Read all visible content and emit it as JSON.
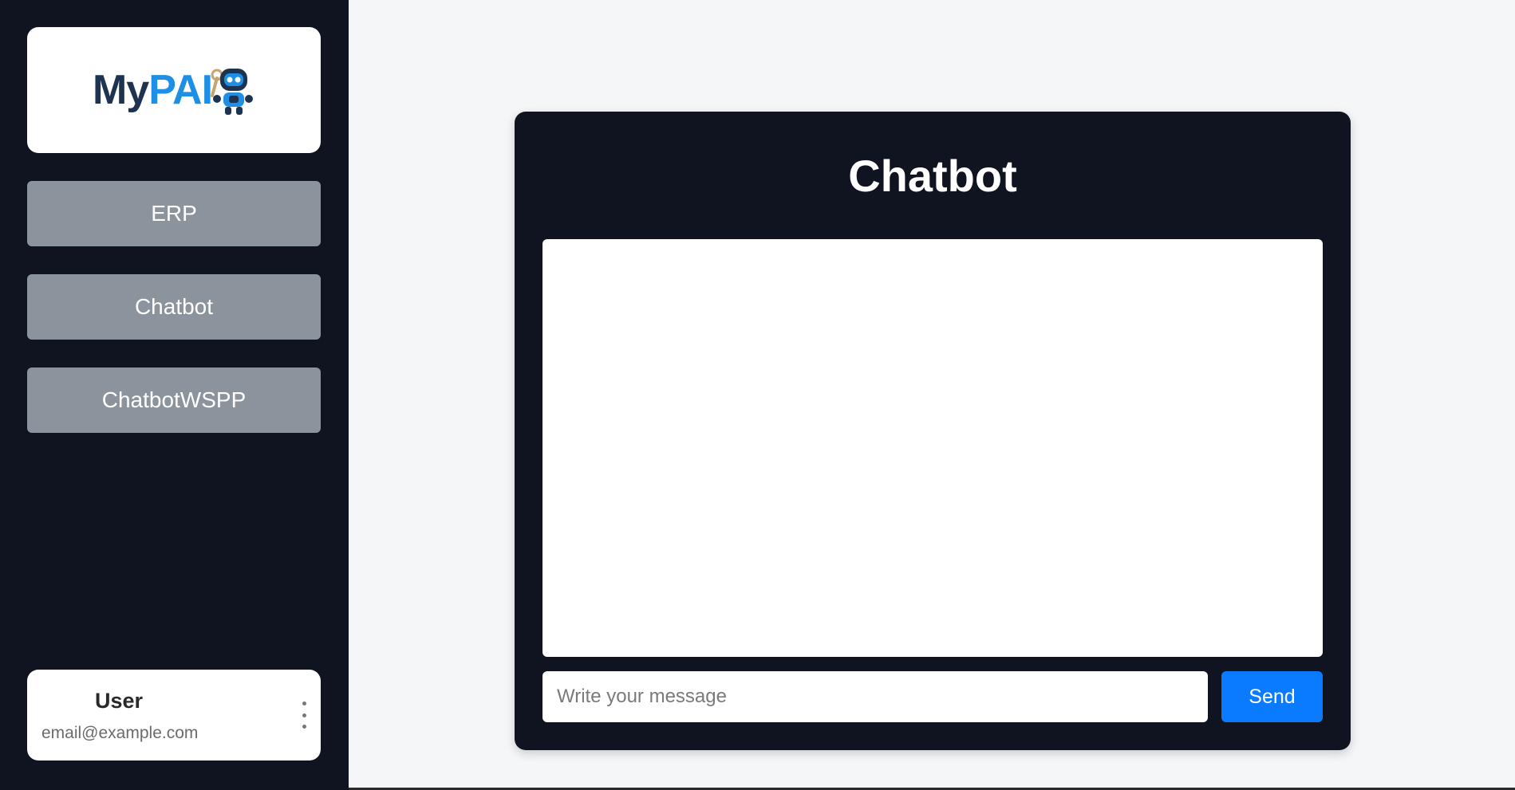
{
  "logo": {
    "text_my": "My",
    "text_pai": "PAI"
  },
  "sidebar": {
    "nav_items": [
      {
        "label": "ERP"
      },
      {
        "label": "Chatbot"
      },
      {
        "label": "ChatbotWSPP"
      }
    ],
    "user": {
      "name": "User",
      "email": "email@example.com",
      "menu_icon": "kebab-vertical-icon"
    }
  },
  "chat": {
    "title": "Chatbot",
    "input_placeholder": "Write your message",
    "input_value": "",
    "send_label": "Send"
  },
  "colors": {
    "sidebar_bg": "#101420",
    "panel_bg": "#101420",
    "nav_button_bg": "#8b939d",
    "send_button_bg": "#0a7bff",
    "page_bg": "#f5f6f8",
    "logo_dark": "#1e3350",
    "logo_blue": "#1e8fe6"
  }
}
